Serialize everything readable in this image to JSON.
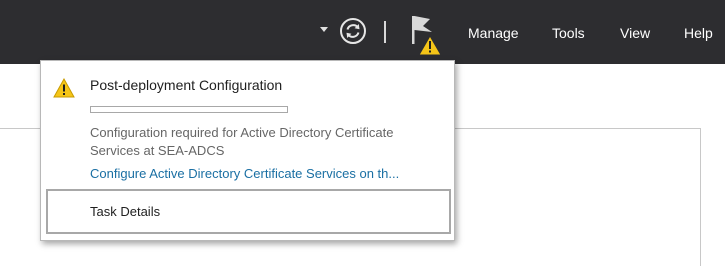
{
  "toolbar": {
    "menu": {
      "manage": "Manage",
      "tools": "Tools",
      "view": "View",
      "help": "Help"
    },
    "icons": [
      "chevron-down-icon",
      "refresh-icon",
      "flag-warning-icon"
    ]
  },
  "notification": {
    "title": "Post-deployment Configuration",
    "progress": 0,
    "description": "Configuration required for Active Directory Certificate Services at SEA-ADCS",
    "link": "Configure Active Directory Certificate Services on th...",
    "task_details": "Task Details"
  },
  "colors": {
    "topbar": "#2d2d30",
    "link": "#1a6fa3",
    "warning": "#f5c518"
  }
}
